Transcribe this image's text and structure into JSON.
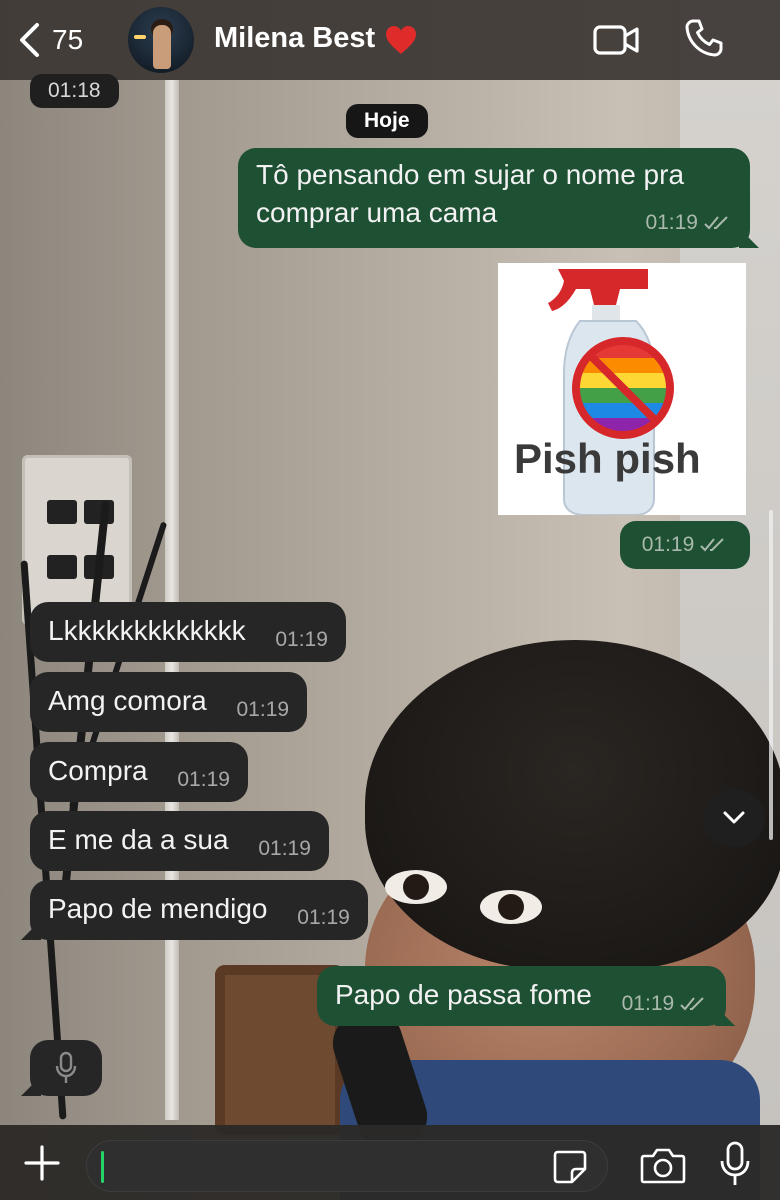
{
  "header": {
    "back_count": "75",
    "contact_name": "Milena Best",
    "heart_emoji_color": "#e02b2b"
  },
  "chat": {
    "prev_time": "01:18",
    "date_separator": "Hoje",
    "messages": [
      {
        "direction": "out",
        "text": "Tô pensando em sujar o nome pra comprar uma cama",
        "time": "01:19",
        "status": "read"
      },
      {
        "direction": "out",
        "type": "sticker",
        "sticker_text": "Pish pish",
        "time": "01:19",
        "status": "read"
      },
      {
        "direction": "in",
        "text": "Lkkkkkkkkkkkkk",
        "time": "01:19"
      },
      {
        "direction": "in",
        "text": "Amg comora",
        "time": "01:19"
      },
      {
        "direction": "in",
        "text": "Compra",
        "time": "01:19"
      },
      {
        "direction": "in",
        "text": "E me da a sua",
        "time": "01:19"
      },
      {
        "direction": "in",
        "text": "Papo de mendigo",
        "time": "01:19"
      },
      {
        "direction": "out",
        "text": "Papo de passa fome",
        "time": "01:19",
        "status": "read"
      }
    ]
  },
  "input": {
    "placeholder": ""
  },
  "colors": {
    "outgoing_bubble": "#1e5034",
    "incoming_bubble": "#262626",
    "accent": "#25d366"
  },
  "icons": [
    "chevron-left-icon",
    "video-camera-icon",
    "phone-icon",
    "chevron-down-icon",
    "microphone-icon",
    "plus-icon",
    "sticker-icon",
    "camera-icon",
    "double-check-icon",
    "heart-icon"
  ]
}
